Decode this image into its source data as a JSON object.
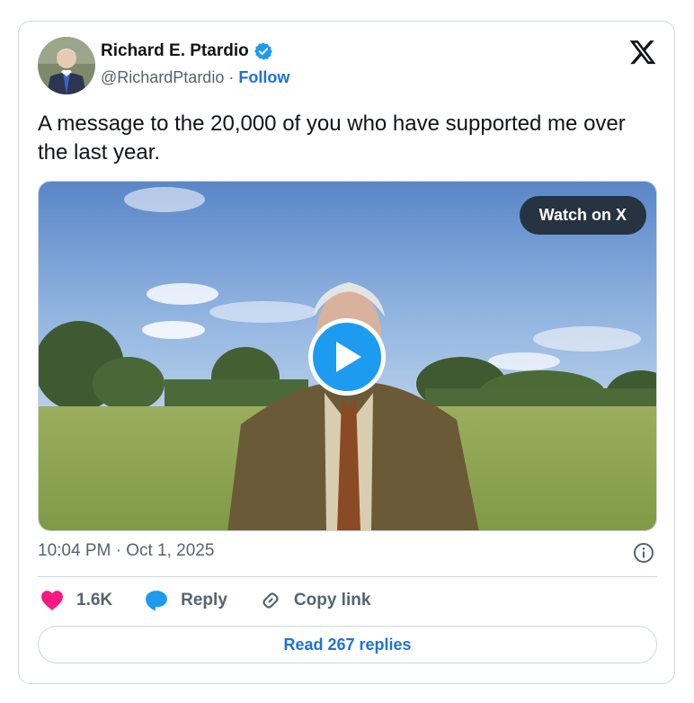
{
  "author": {
    "name": "Richard E. Ptardio",
    "handle": "@RichardPtardio",
    "separator": "·",
    "follow_label": "Follow",
    "verified_color": "#1d9bf0"
  },
  "platform_icon": "x-logo-icon",
  "tweet": {
    "text": "A message to the 20,000 of you who have supported me over the last year."
  },
  "media": {
    "type": "video",
    "watch_label": "Watch on X",
    "play_icon": "play-icon"
  },
  "meta": {
    "timestamp": "10:04 PM · Oct 1, 2025"
  },
  "actions": {
    "likes": "1.6K",
    "reply_label": "Reply",
    "copy_link_label": "Copy link"
  },
  "read_replies_label": "Read 267 replies",
  "colors": {
    "accent": "#1d72d6",
    "heart": "#f91880",
    "reply_bubble": "#1d9bf0",
    "text_secondary": "#536471"
  }
}
